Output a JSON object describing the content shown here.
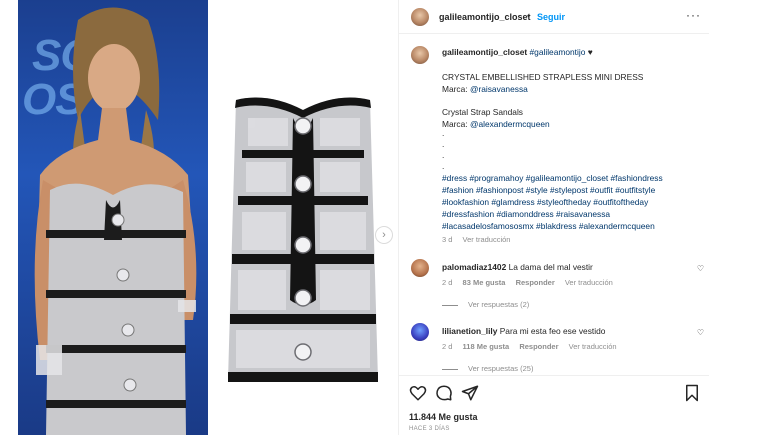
{
  "post": {
    "username": "galileamontijo_closet",
    "follow_label": "Seguir",
    "separator": "•",
    "more_label": "···"
  },
  "media": {
    "background_text": [
      "SOS",
      "OS"
    ],
    "next_label": "›"
  },
  "caption": {
    "username": "galileamontijo_closet",
    "mention": "#galileamontijo",
    "heart": "♥",
    "lines": [
      "CRYSTAL EMBELLISHED STRAPLESS MINI DRESS",
      "Marca: ",
      "Crystal Strap Sandals",
      "Marca: "
    ],
    "brand1": "@raisavanessa",
    "brand2": "@alexandermcqueen",
    "dots": [
      ".",
      ".",
      ".",
      "."
    ],
    "hashtags": [
      "#dress #programahoy #galileamontijo_closet #fashiondress",
      "#fashion #fashionpost #style #stylepost #outfit #outfitstyle",
      "#lookfashion #glamdress #styleoftheday #outfitoftheday",
      "#dressfashion #diamonddress #raisavanessa",
      "#lacasadelosfamososmx #blakdress #alexandermcqueen"
    ],
    "age": "3 d",
    "translate": "Ver traducción"
  },
  "comments": [
    {
      "username": "palomadiaz1402",
      "text": "La dama del mal vestir",
      "age": "2 d",
      "likes": "83 Me gusta",
      "reply": "Responder",
      "translate": "Ver traducción",
      "replies": "Ver respuestas (2)"
    },
    {
      "username": "lilianetion_lily",
      "text": "Para mi esta feo ese vestido",
      "age": "2 d",
      "likes": "118 Me gusta",
      "reply": "Responder",
      "translate": "Ver traducción",
      "replies": "Ver respuestas (25)"
    }
  ],
  "footer": {
    "likes": "11.844 Me gusta",
    "time": "HACE 3 DÍAS"
  },
  "icons": {
    "like": "heart-icon",
    "comment": "comment-icon",
    "share": "paper-plane-icon",
    "save": "bookmark-icon",
    "comment_like": "small-heart-icon"
  },
  "colors": {
    "link": "#00376b",
    "follow": "#0095f6",
    "muted": "#8e8e8e"
  }
}
